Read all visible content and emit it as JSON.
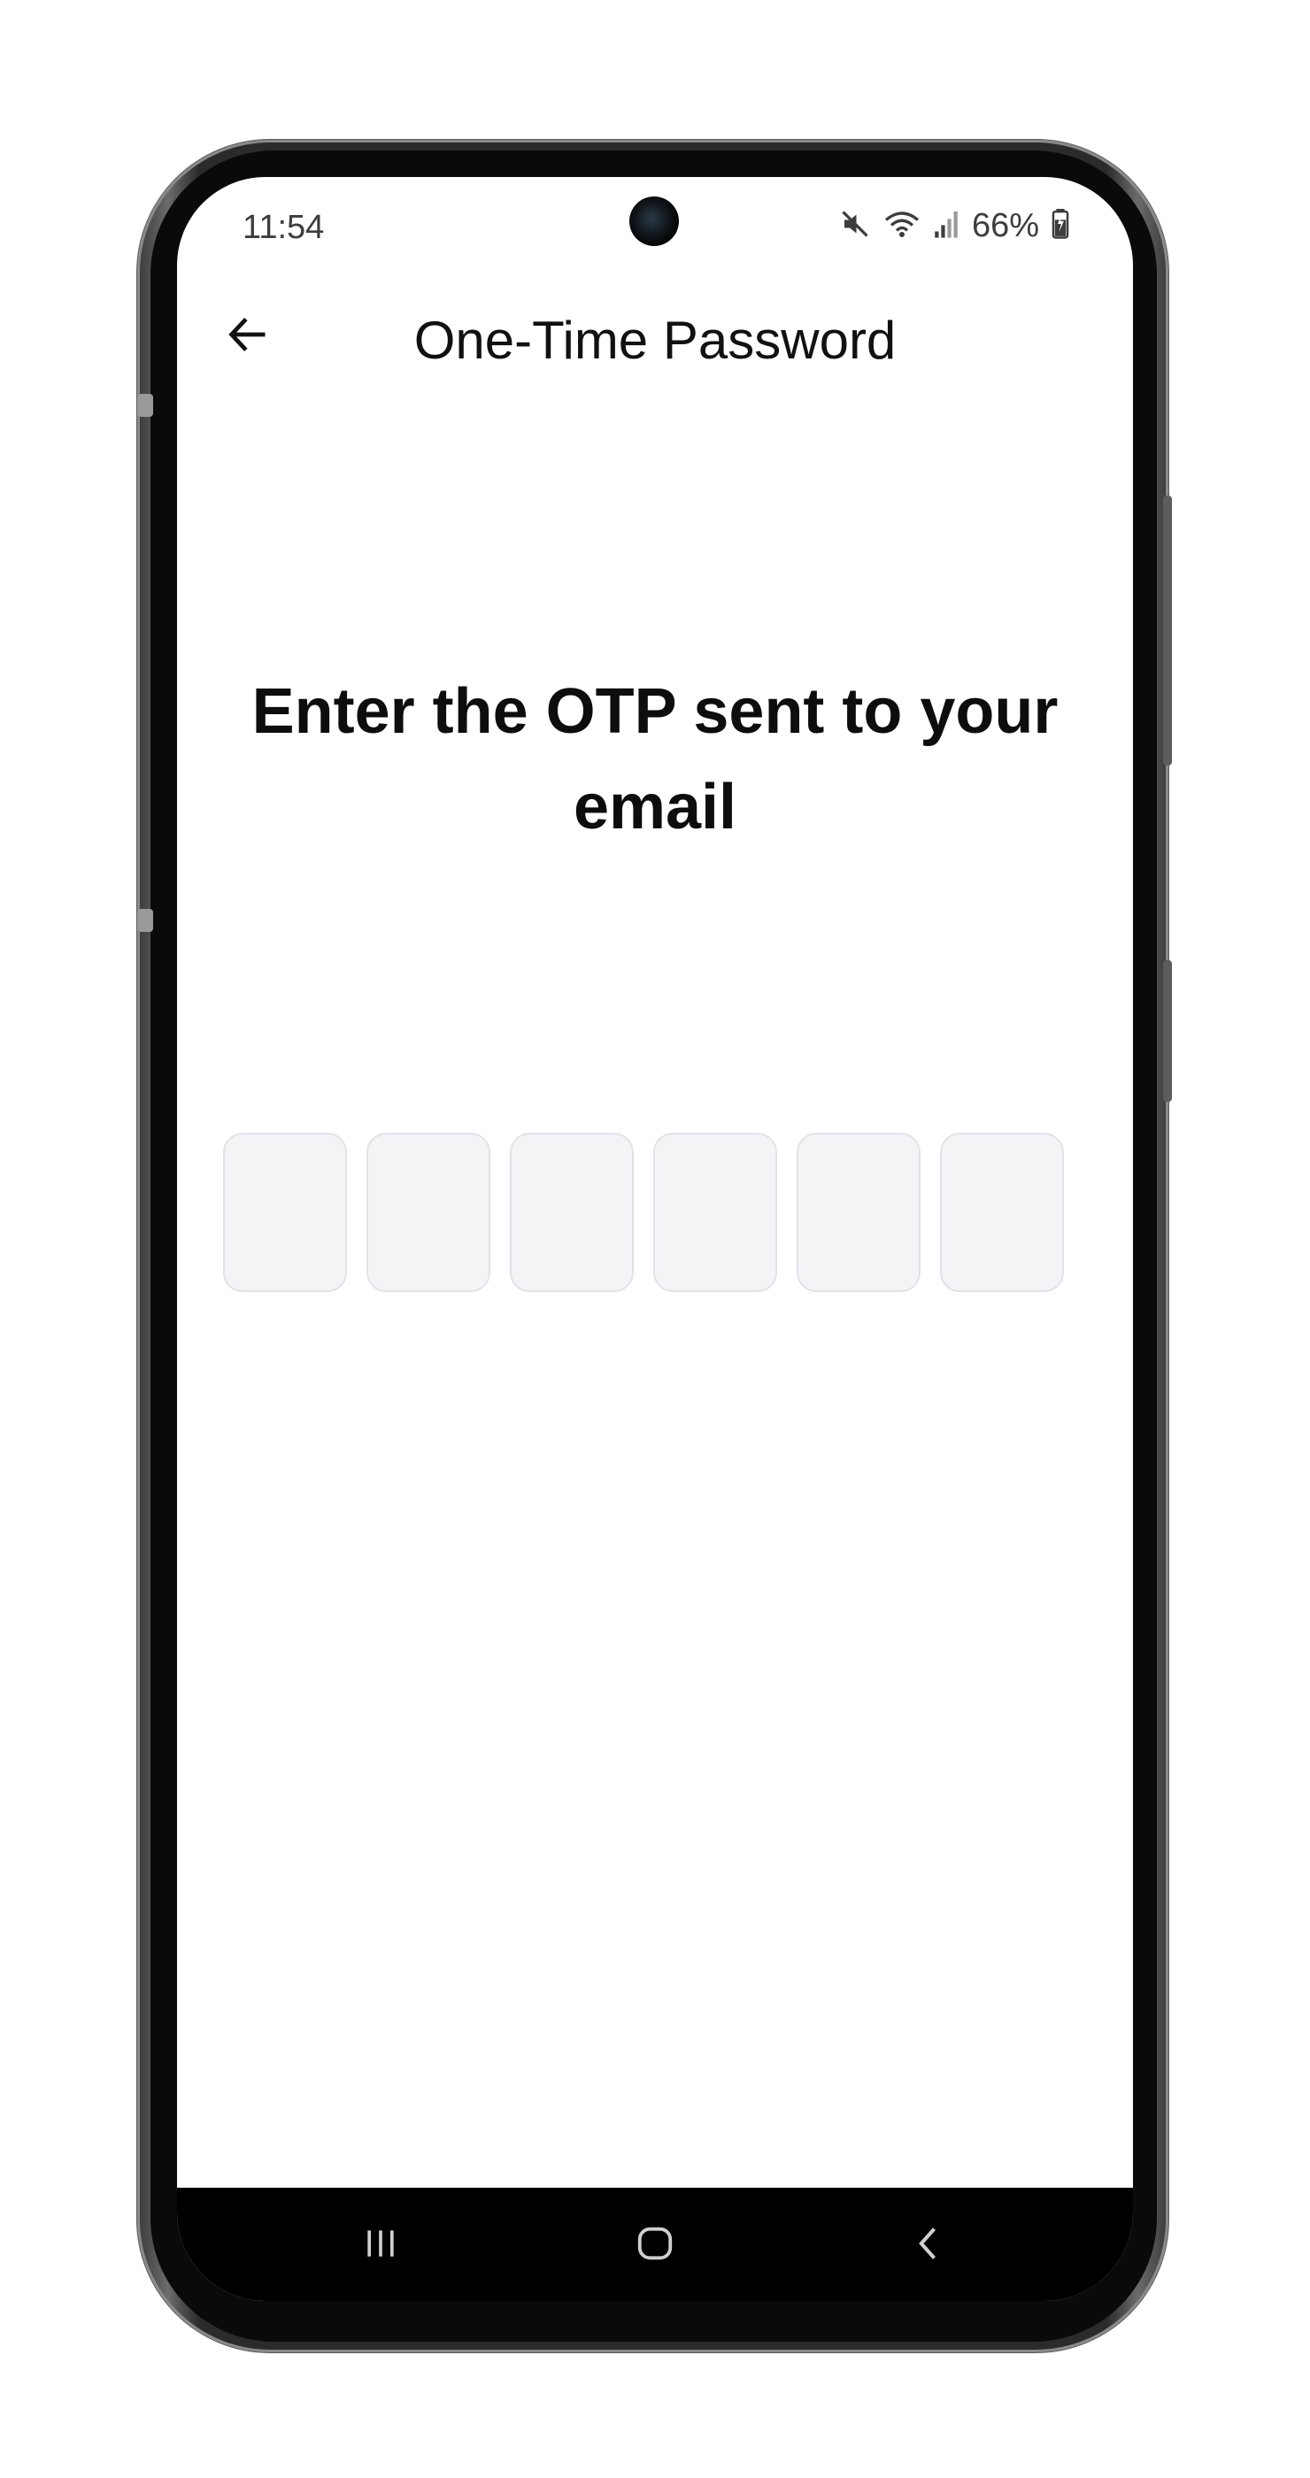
{
  "status_bar": {
    "time": "11:54",
    "battery": "66%",
    "icons": [
      "mute-icon",
      "wifi-icon",
      "signal-icon",
      "battery-icon"
    ]
  },
  "app_bar": {
    "title": "One-Time Password",
    "back_icon": "arrow-left-icon"
  },
  "main": {
    "heading": "Enter the OTP sent to your email",
    "otp_fields": [
      {
        "value": ""
      },
      {
        "value": ""
      },
      {
        "value": ""
      },
      {
        "value": ""
      },
      {
        "value": ""
      },
      {
        "value": ""
      }
    ]
  },
  "nav_bar": {
    "buttons": [
      "recent-apps-icon",
      "home-icon",
      "back-icon"
    ]
  },
  "colors": {
    "otp_box_bg": "#f3f4f6",
    "otp_box_border": "#e1e3ea",
    "text": "#111111",
    "nav_bg": "#000000"
  }
}
